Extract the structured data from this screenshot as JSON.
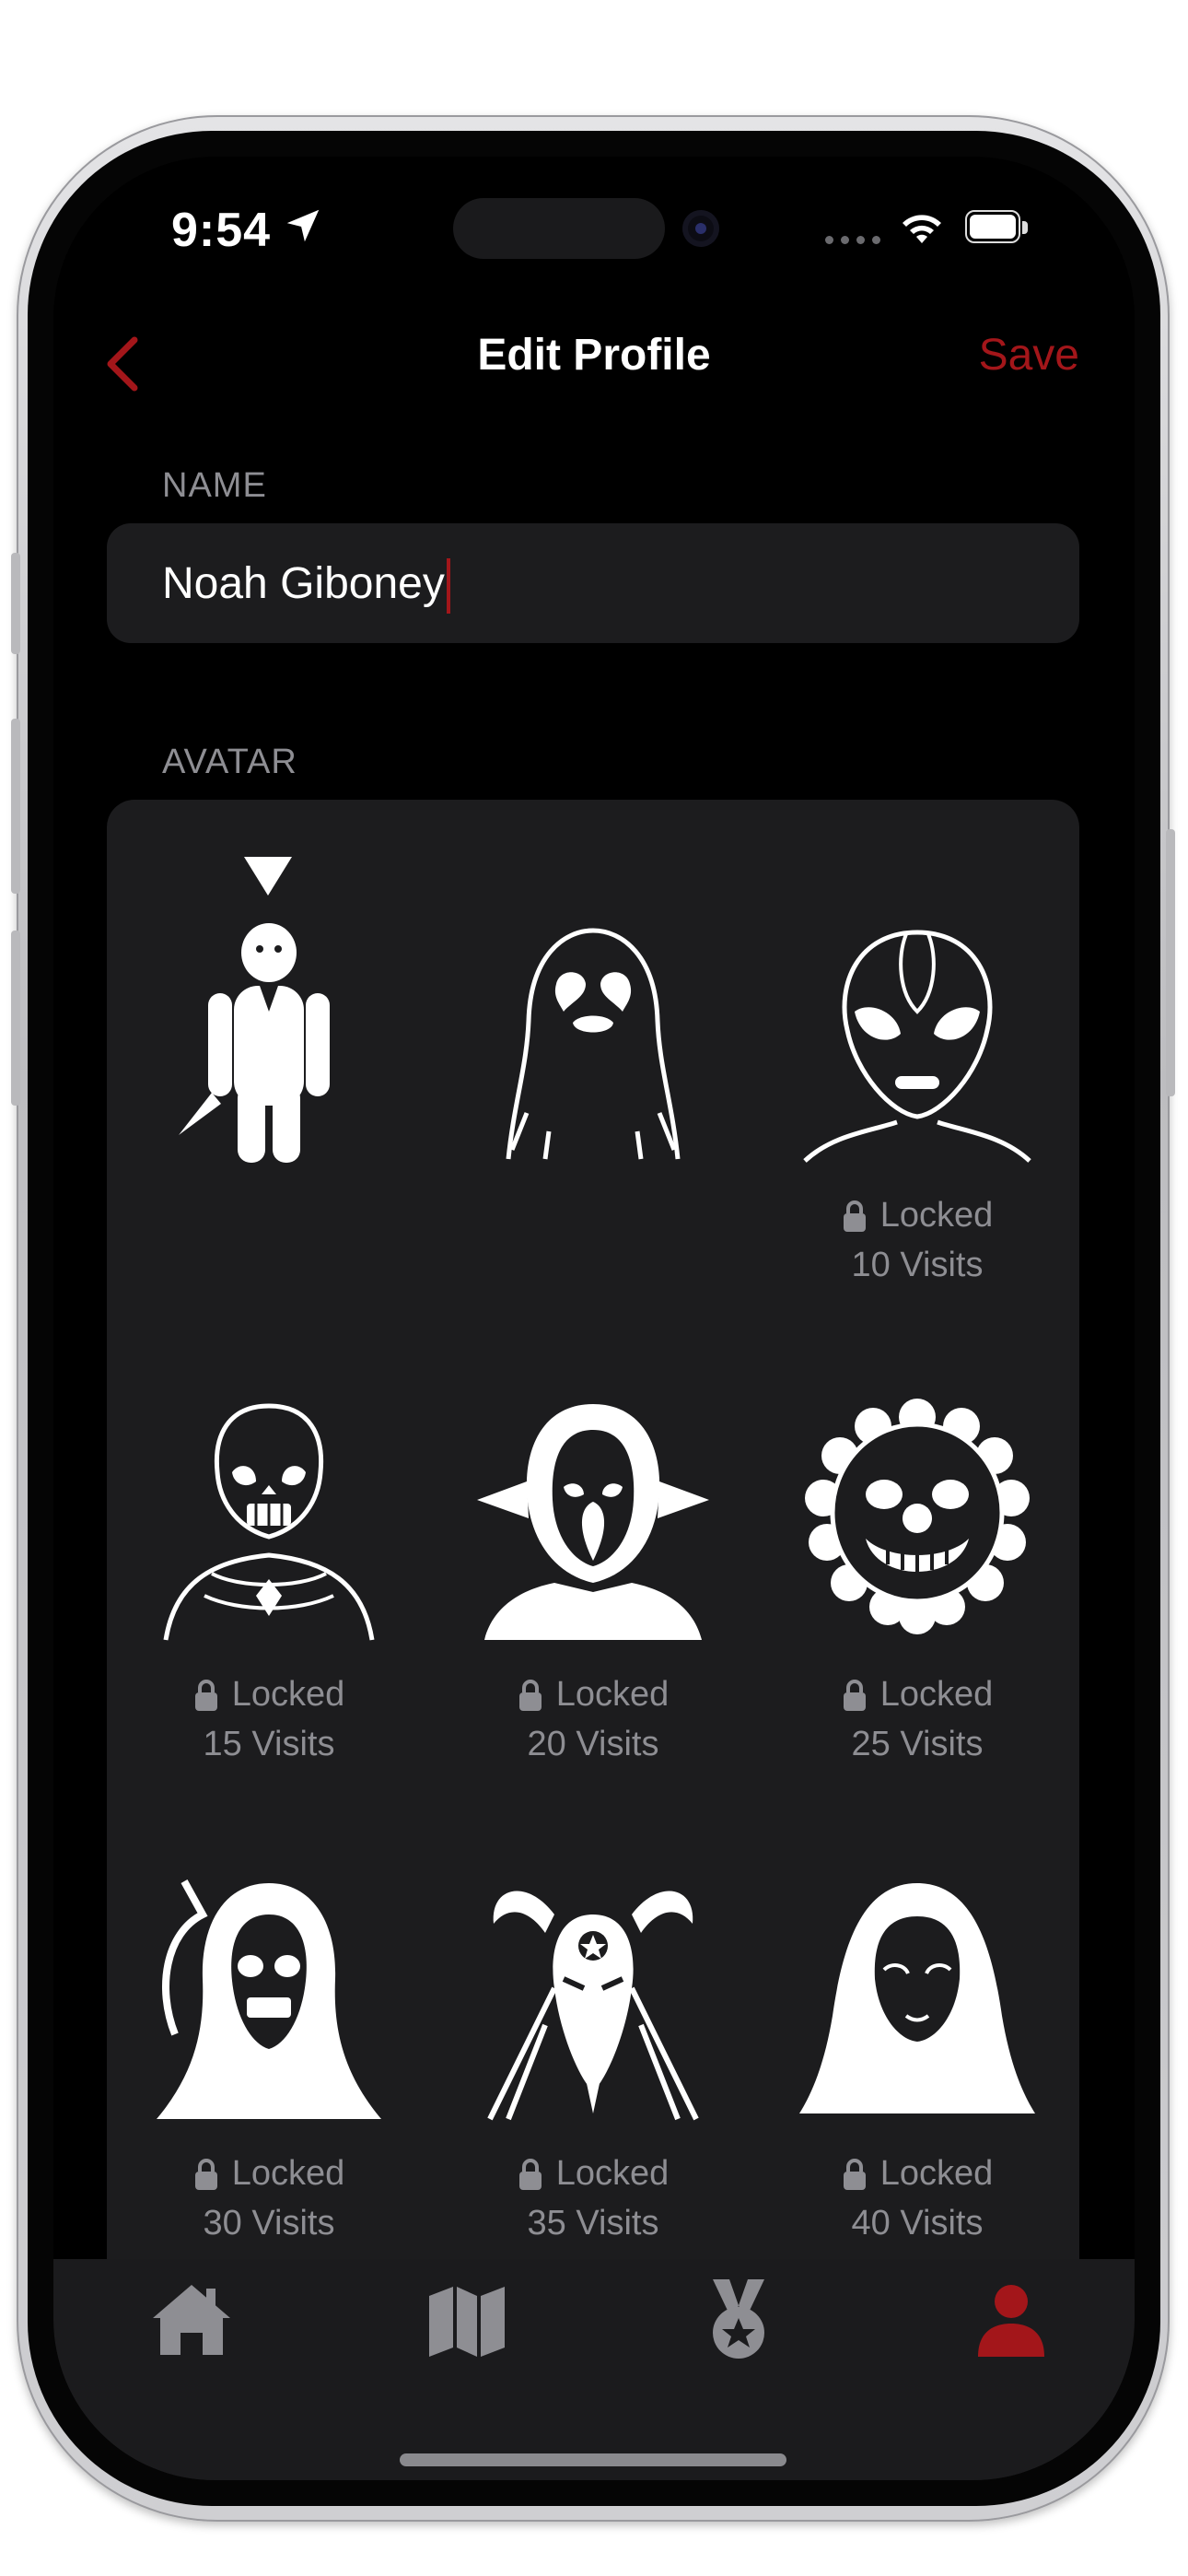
{
  "status_bar": {
    "time": "9:54"
  },
  "nav": {
    "title": "Edit Profile",
    "save_label": "Save"
  },
  "name_section": {
    "label": "NAME",
    "value": "Noah Giboney"
  },
  "avatar_section": {
    "label": "AVATAR",
    "avatars": [
      {
        "icon": "slasher-killer-icon",
        "selected": true
      },
      {
        "icon": "ghost-icon"
      },
      {
        "icon": "alien-icon",
        "status": "Locked",
        "requirement": "10 Visits"
      },
      {
        "icon": "skeleton-alien-icon",
        "status": "Locked",
        "requirement": "15 Visits"
      },
      {
        "icon": "goblin-hood-icon",
        "status": "Locked",
        "requirement": "20 Visits"
      },
      {
        "icon": "clown-icon",
        "status": "Locked",
        "requirement": "25 Visits"
      },
      {
        "icon": "grim-reaper-icon",
        "status": "Locked",
        "requirement": "30 Visits"
      },
      {
        "icon": "goat-demon-icon",
        "status": "Locked",
        "requirement": "35 Visits"
      },
      {
        "icon": "hooded-mask-icon",
        "status": "Locked",
        "requirement": "40 Visits"
      }
    ]
  },
  "tab_bar": {
    "tabs": [
      {
        "icon": "home-icon"
      },
      {
        "icon": "map-icon"
      },
      {
        "icon": "medal-icon"
      },
      {
        "icon": "profile-icon",
        "active": true
      }
    ]
  },
  "colors": {
    "accent": "#a3161a",
    "background": "#000000",
    "panel": "#1c1c1e",
    "secondary_text": "#8e8e93"
  }
}
